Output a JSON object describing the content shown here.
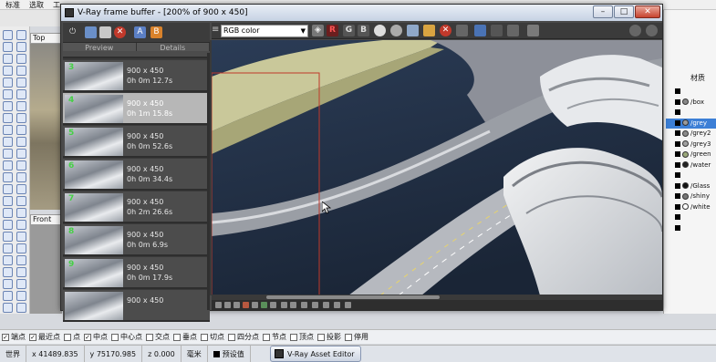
{
  "host_app": {
    "menu": [
      "标准",
      "选取",
      "工"
    ],
    "viewports": {
      "top_label": "Top",
      "front_label": "Front"
    },
    "right_panel": {
      "header": "材质",
      "materials": [
        {
          "name": "",
          "selected": false,
          "swatch": "none"
        },
        {
          "name": "/box",
          "selected": false,
          "swatch": "#888888"
        },
        {
          "name": "",
          "selected": false,
          "swatch": "none"
        },
        {
          "name": "/grey",
          "selected": true,
          "swatch": "#9a9a9a"
        },
        {
          "name": "/grey2",
          "selected": false,
          "swatch": "#8a8a8a"
        },
        {
          "name": "/grey3",
          "selected": false,
          "swatch": "#a0a0a0"
        },
        {
          "name": "/green",
          "selected": false,
          "swatch": "#9aa87a"
        },
        {
          "name": "/water",
          "selected": false,
          "swatch": "#222222"
        },
        {
          "name": "",
          "selected": false,
          "swatch": "none"
        },
        {
          "name": "/Glass",
          "selected": false,
          "swatch": "#111111"
        },
        {
          "name": "/shiny",
          "selected": false,
          "swatch": "#777777"
        },
        {
          "name": "/white",
          "selected": false,
          "swatch": "#ffffff"
        },
        {
          "name": "",
          "selected": false,
          "swatch": "none"
        },
        {
          "name": "",
          "selected": false,
          "swatch": "none"
        }
      ]
    },
    "snaps": [
      {
        "label": "端点",
        "checked": true
      },
      {
        "label": "最近点",
        "checked": true
      },
      {
        "label": "点",
        "checked": false
      },
      {
        "label": "中点",
        "checked": true
      },
      {
        "label": "中心点",
        "checked": false
      },
      {
        "label": "交点",
        "checked": false
      },
      {
        "label": "垂点",
        "checked": false
      },
      {
        "label": "切点",
        "checked": false
      },
      {
        "label": "四分点",
        "checked": false
      },
      {
        "label": "节点",
        "checked": false
      },
      {
        "label": "顶点",
        "checked": false
      },
      {
        "label": "投影",
        "checked": false
      },
      {
        "label": "停用",
        "checked": false
      }
    ],
    "status": {
      "cplane": "世界",
      "x": "x 41489.835",
      "y": "y 75170.985",
      "z": "z 0.000",
      "units": "毫米",
      "layer": "预设值"
    },
    "taskbar_item": "V-Ray Asset Editor"
  },
  "vfb": {
    "title": "V-Ray frame buffer - [200% of 900 x 450]",
    "history": {
      "col_preview": "Preview",
      "col_details": "Details",
      "entries": [
        {
          "num": "",
          "size": "",
          "time": ""
        },
        {
          "num": "3",
          "size": "900 x 450",
          "time": "0h 0m 12.7s"
        },
        {
          "num": "4",
          "size": "900 x 450",
          "time": "0h 1m 15.8s",
          "selected": true
        },
        {
          "num": "5",
          "size": "900 x 450",
          "time": "0h 0m 52.6s"
        },
        {
          "num": "6",
          "size": "900 x 450",
          "time": "0h 0m 34.4s"
        },
        {
          "num": "7",
          "size": "900 x 450",
          "time": "0h 2m 26.6s"
        },
        {
          "num": "8",
          "size": "900 x 450",
          "time": "0h 0m 6.9s"
        },
        {
          "num": "9",
          "size": "900 x 450",
          "time": "0h 0m 17.9s"
        },
        {
          "num": "",
          "size": "900 x 450",
          "time": ""
        }
      ]
    },
    "toolbar": {
      "channel": "RGB color",
      "channel_buttons": [
        "R",
        "G",
        "B"
      ]
    },
    "colors": {
      "window_bg": "#4a4a4a",
      "history_num": "#45d045",
      "accent_red": "#c0392b"
    }
  }
}
